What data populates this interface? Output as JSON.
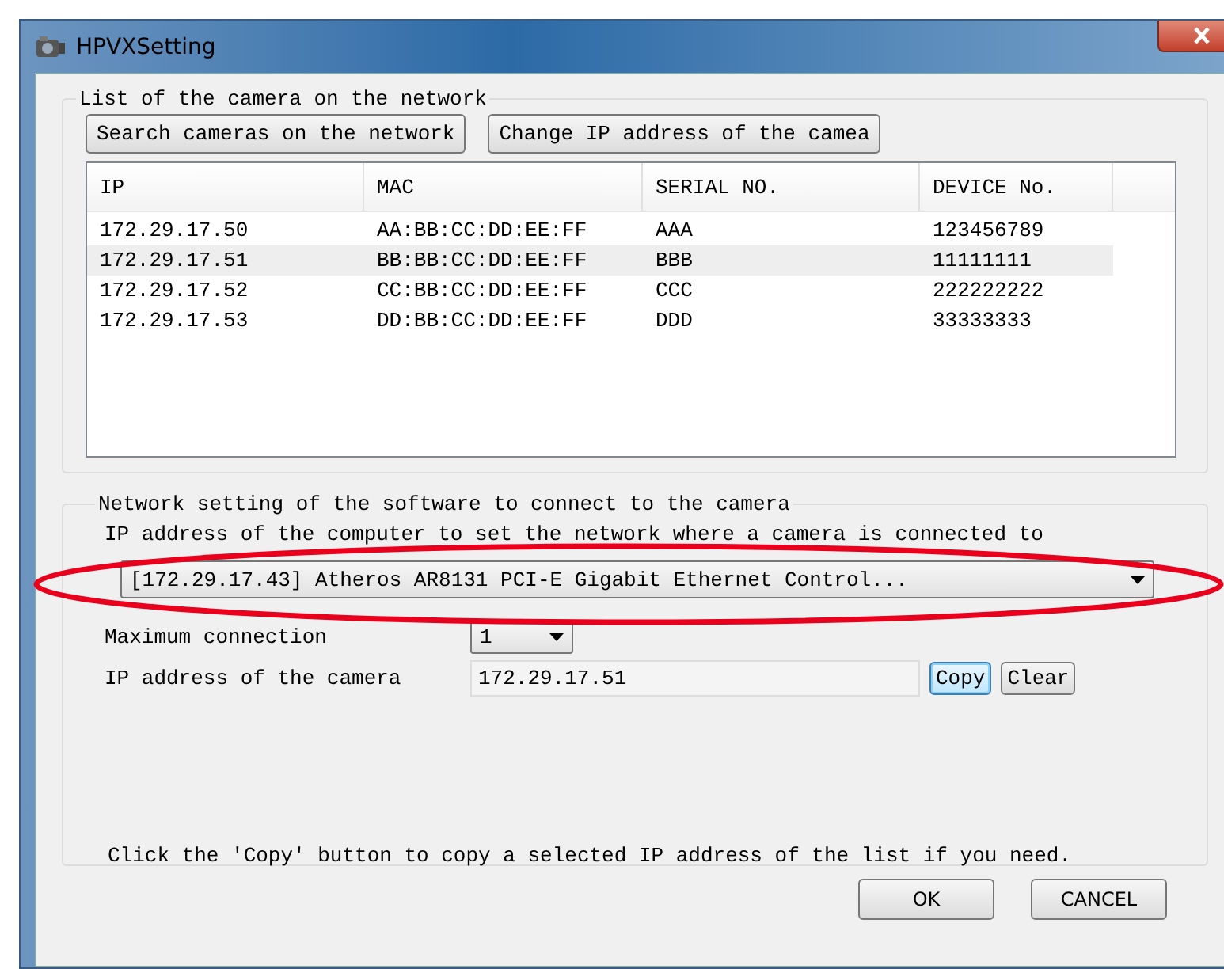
{
  "window": {
    "title": "HPVXSetting"
  },
  "camera_list": {
    "legend": "List of the camera on the network",
    "buttons": [
      "Search cameras on the network",
      "Change IP address of the camea"
    ],
    "columns": [
      "IP",
      "MAC",
      "SERIAL NO.",
      "DEVICE No."
    ],
    "rows": [
      {
        "cells": [
          "172.29.17.50",
          "AA:BB:CC:DD:EE:FF",
          "AAA",
          "123456789"
        ],
        "selected": false
      },
      {
        "cells": [
          "172.29.17.51",
          "BB:BB:CC:DD:EE:FF",
          "BBB",
          "11111111"
        ],
        "selected": true
      },
      {
        "cells": [
          "172.29.17.52",
          "CC:BB:CC:DD:EE:FF",
          "CCC",
          "222222222"
        ],
        "selected": false
      },
      {
        "cells": [
          "172.29.17.53",
          "DD:BB:CC:DD:EE:FF",
          "DDD",
          "33333333"
        ],
        "selected": false
      }
    ]
  },
  "network": {
    "legend": "Network setting of the software to connect to the camera",
    "adapter_label": "IP address of the computer to set the network where a camera is connected to",
    "adapter_value": "[172.29.17.43] Atheros AR8131 PCI-E Gigabit Ethernet Control...",
    "max_label": "Maximum connection",
    "max_value": "1",
    "ip_label": "IP address of the camera",
    "ip_value": "172.29.17.51",
    "copy_button": {
      "label": "Copy",
      "focused": true
    },
    "clear_button": {
      "label": "Clear",
      "focused": false
    },
    "note": "Click the 'Copy' button to copy a selected IP address of the list if you need."
  },
  "annotations": [
    {
      "kind": "ellipse",
      "color": "#e8001c"
    }
  ],
  "buttons": [
    "OK",
    "CANCEL"
  ]
}
